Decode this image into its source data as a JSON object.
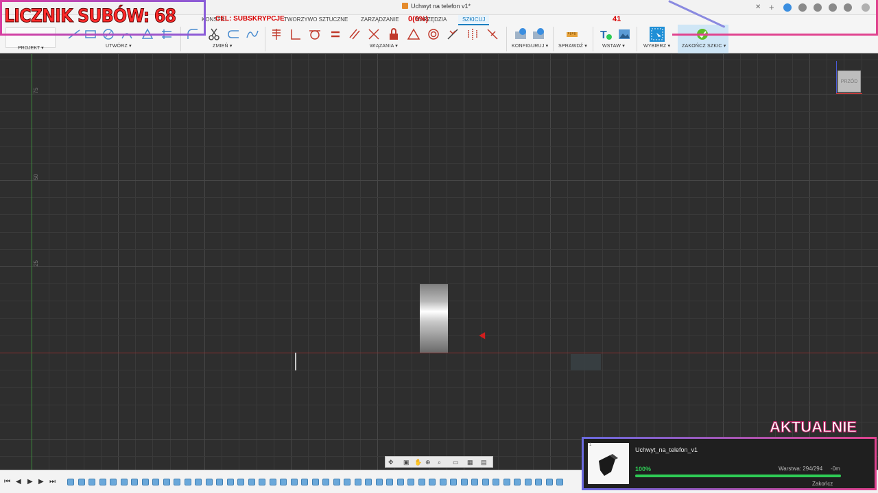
{
  "window": {
    "document_title": "Uchwyt na telefon v1*"
  },
  "ribbon": {
    "tabs": [
      {
        "label": "KONSTR."
      },
      {
        "label": "TWORZYWO SZTUCZNE"
      },
      {
        "label": "ZARZĄDZANIE"
      },
      {
        "label": "NARZĘDZIA"
      },
      {
        "label": "SZKICUJ",
        "active": true
      }
    ],
    "project_label": "PROJEKT",
    "groups": {
      "create": "UTWÓRZ",
      "modify": "ZMIEŃ",
      "constraints": "WIĄZANIA",
      "configure": "KONFIGURUJ",
      "inspect": "SPRAWDŹ",
      "insert": "WSTAW",
      "select": "WYBIERZ",
      "finish": "ZAKOŃCZ SZKIC"
    }
  },
  "viewport": {
    "y_axis_labels": [
      "75",
      "50",
      "25"
    ],
    "viewcube_label": "PRZÓD"
  },
  "stream_overlay": {
    "sub_counter": "LICZNIK SUBÓW: 68",
    "goal_label": "CEL: SUBSKRYPCJE",
    "goal_progress": "0(0%)",
    "goal_count": "41",
    "now_printing_label": "AKTUALNIE",
    "printer": {
      "thumb_index": "1",
      "file_name": "Uchwyt_na_telefon_v1",
      "progress_label": "100%",
      "progress": 1.0,
      "layer": "Warstwa: 294/294",
      "remaining": "-0m",
      "status": "Zakończ"
    }
  },
  "colors": {
    "accent": "#1a7fc1",
    "axis_green": "#3e8e3e",
    "axis_red": "#8a2f2f",
    "overlay_red": "#ff2a2a",
    "progress_green": "#2ecc55",
    "frame_pink": "#e0438f"
  }
}
